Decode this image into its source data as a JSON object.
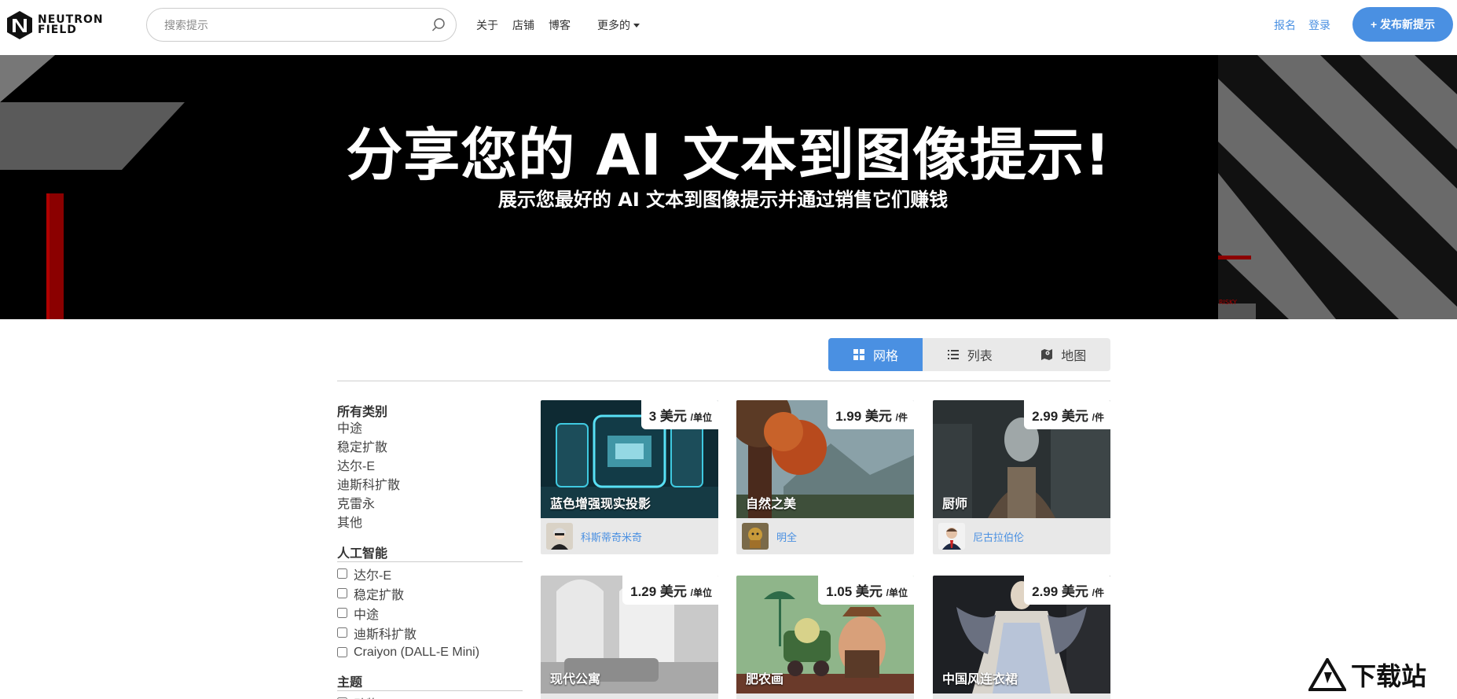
{
  "brand": {
    "logo_line1": "NEUTRON",
    "logo_line2": "FIELD"
  },
  "search": {
    "placeholder": "搜索提示"
  },
  "nav": {
    "about": "关于",
    "shops": "店铺",
    "blog": "博客",
    "more": "更多的"
  },
  "auth": {
    "signup": "报名",
    "login": "登录"
  },
  "publish_button": "+ 发布新提示",
  "hero": {
    "title": "分享您的 AI 文本到图像提示!",
    "subtitle": "展示您最好的 AI 文本到图像提示并通过销售它们赚钱",
    "deco_text": "RISKY"
  },
  "view_toggle": {
    "grid": "网格",
    "list": "列表",
    "map": "地图"
  },
  "sidebar": {
    "categories_title": "所有类别",
    "categories": [
      "中途",
      "稳定扩散",
      "达尔-E",
      "迪斯科扩散",
      "克雷永",
      "其他"
    ],
    "ai_title": "人工智能",
    "ai_options": [
      "达尔-E",
      "稳定扩散",
      "中途",
      "迪斯科扩散",
      "Craiyon (DALL-E Mini)"
    ],
    "theme_title": "主题",
    "theme_options": [
      "动物"
    ]
  },
  "cards": [
    {
      "title": "蓝色增强现实投影",
      "price": "3 美元",
      "unit": "/单位",
      "author": "科斯蒂奇米奇"
    },
    {
      "title": "自然之美",
      "price": "1.99 美元",
      "unit": "/件",
      "author": "明全"
    },
    {
      "title": "厨师",
      "price": "2.99 美元",
      "unit": "/件",
      "author": "尼古拉伯伦"
    },
    {
      "title": "现代公寓",
      "price": "1.29 美元",
      "unit": "/单位",
      "author": ""
    },
    {
      "title": "肥农画",
      "price": "1.05 美元",
      "unit": "/单位",
      "author": ""
    },
    {
      "title": "中国风连衣裙",
      "price": "2.99 美元",
      "unit": "/件",
      "author": ""
    }
  ],
  "watermark": "下载站",
  "colors": {
    "accent": "#4a90e2",
    "hero_bg": "#000000"
  }
}
